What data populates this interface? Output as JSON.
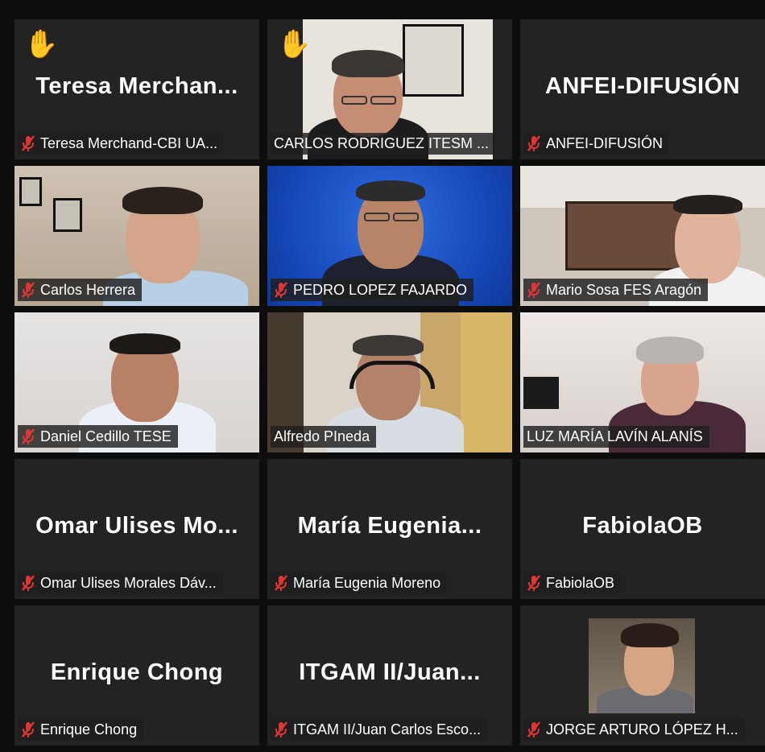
{
  "participants": [
    {
      "big_name": "Teresa  Merchan...",
      "label": "Teresa Merchand-CBI UA...",
      "muted": true,
      "hand_raised": true,
      "video": false
    },
    {
      "big_name": "",
      "label": "CARLOS RODRIGUEZ ITESM ...",
      "muted": false,
      "hand_raised": true,
      "video": true,
      "active_speaker": true
    },
    {
      "big_name": "ANFEI-DIFUSIÓN",
      "label": "ANFEI-DIFUSIÓN",
      "muted": true,
      "hand_raised": false,
      "video": false
    },
    {
      "big_name": "",
      "label": "Carlos Herrera",
      "muted": true,
      "video": true
    },
    {
      "big_name": "",
      "label": "PEDRO LOPEZ FAJARDO",
      "muted": true,
      "video": true
    },
    {
      "big_name": "",
      "label": "Mario Sosa FES Aragón",
      "muted": true,
      "video": true
    },
    {
      "big_name": "",
      "label": "Daniel Cedillo TESE",
      "muted": true,
      "video": true
    },
    {
      "big_name": "",
      "label": "Alfredo PIneda",
      "muted": false,
      "video": true
    },
    {
      "big_name": "",
      "label": "LUZ MARÍA LAVÍN ALANÍS",
      "muted": false,
      "video": true
    },
    {
      "big_name": "Omar  Ulises  Mo...",
      "label": "Omar Ulises Morales Dáv...",
      "muted": true,
      "video": false
    },
    {
      "big_name": "María  Eugenia...",
      "label": "María Eugenia Moreno",
      "muted": true,
      "video": false
    },
    {
      "big_name": "FabiolaOB",
      "label": "FabiolaOB",
      "muted": true,
      "video": false
    },
    {
      "big_name": "Enrique Chong",
      "label": "Enrique Chong",
      "muted": true,
      "video": false
    },
    {
      "big_name": "ITGAM  II/Juan...",
      "label": "ITGAM II/Juan Carlos Esco...",
      "muted": true,
      "video": false
    },
    {
      "big_name": "",
      "label": "JORGE ARTURO LÓPEZ H...",
      "muted": true,
      "video": false,
      "profile_picture": true
    }
  ],
  "colors": {
    "tile_bg": "#232323",
    "active_border": "#d7e84a",
    "mute_icon": "#e03535",
    "hand_icon": "#f5b70c"
  }
}
